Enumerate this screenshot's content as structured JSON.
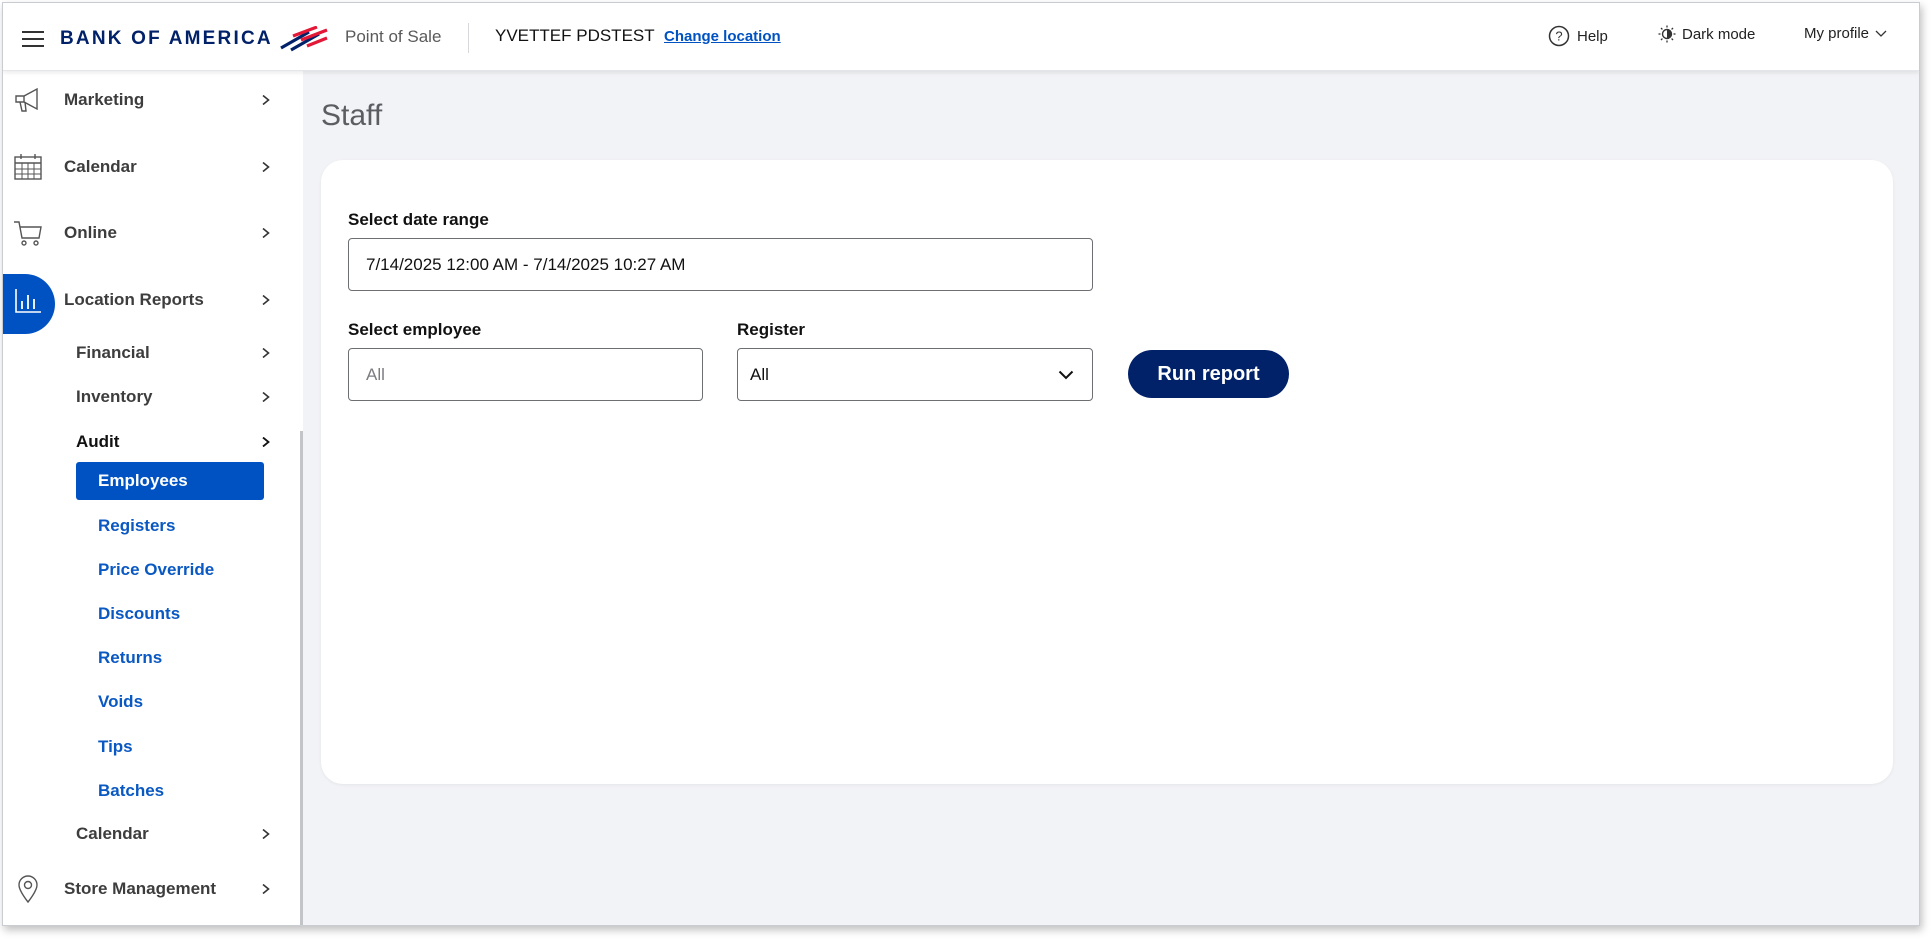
{
  "header": {
    "logo_text": "BANK OF AMERICA",
    "product": "Point of Sale",
    "store": "YVETTEF PDSTEST",
    "change_location": "Change location",
    "help": "Help",
    "dark_mode": "Dark mode",
    "profile": "My profile"
  },
  "sidebar": {
    "items": [
      {
        "label": "Marketing",
        "icon": "megaphone-icon"
      },
      {
        "label": "Calendar",
        "icon": "calendar-icon"
      },
      {
        "label": "Online",
        "icon": "cart-icon"
      },
      {
        "label": "Location Reports",
        "icon": "bar-chart-icon"
      },
      {
        "label": "Store Management",
        "icon": "location-pin-icon"
      }
    ],
    "sub_items": [
      {
        "label": "Financial"
      },
      {
        "label": "Inventory"
      },
      {
        "label": "Audit"
      },
      {
        "label": "Calendar"
      }
    ],
    "audit_items": [
      {
        "label": "Employees"
      },
      {
        "label": "Registers"
      },
      {
        "label": "Price Override"
      },
      {
        "label": "Discounts"
      },
      {
        "label": "Returns"
      },
      {
        "label": "Voids"
      },
      {
        "label": "Tips"
      },
      {
        "label": "Batches"
      }
    ],
    "selected": "Employees"
  },
  "main": {
    "title": "Staff",
    "date_range_label": "Select date range",
    "date_range_value": "7/14/2025 12:00 AM - 7/14/2025 10:27 AM",
    "employee_label": "Select employee",
    "employee_placeholder": "All",
    "register_label": "Register",
    "register_value": "All",
    "run_button": "Run report"
  },
  "colors": {
    "brand_navy": "#012169",
    "accent_blue": "#0052c2",
    "brand_red": "#e31837",
    "background": "#f2f3f6"
  }
}
